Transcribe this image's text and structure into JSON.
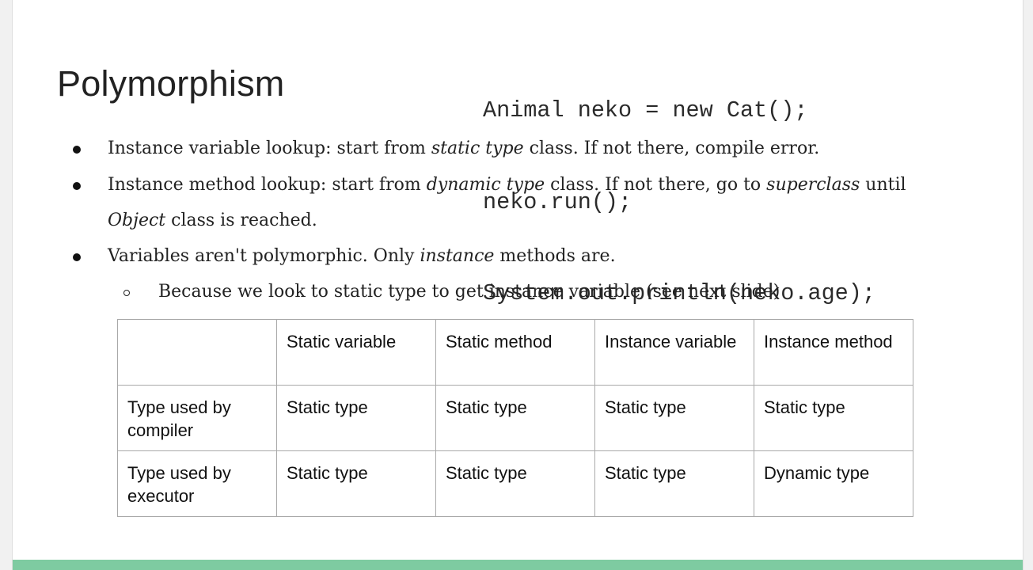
{
  "slide": {
    "title": "Polymorphism",
    "code_lines": [
      "Animal neko = new Cat();",
      "neko.run();",
      "System.out.println(neko.age);"
    ],
    "bullets": {
      "b1": {
        "t1": "Instance variable lookup: start from ",
        "i1": "static type",
        "t2": " class. If not there, compile error."
      },
      "b2": {
        "t1": "Instance method lookup: start from ",
        "i1": "dynamic type",
        "t2": " class. If not there, go to ",
        "i2": "superclass",
        "t3": " until"
      },
      "b2c": {
        "i1": "Object",
        "t1": " class is reached."
      },
      "b3": {
        "t1": "Variables aren't polymorphic. Only ",
        "i1": "instance",
        "t2": " methods are."
      },
      "b4": {
        "t1": "Because we look to static type to get instance variable (see next slide)"
      }
    },
    "table": {
      "header": [
        "",
        "Static variable",
        "Static method",
        "Instance variable",
        "Instance method"
      ],
      "rows": [
        [
          "Type used by compiler",
          "Static type",
          "Static type",
          "Static type",
          "Static type"
        ],
        [
          "Type used by executor",
          "Static type",
          "Static type",
          "Static type",
          "Dynamic type"
        ]
      ]
    },
    "accent_color": "#7ecba1"
  }
}
